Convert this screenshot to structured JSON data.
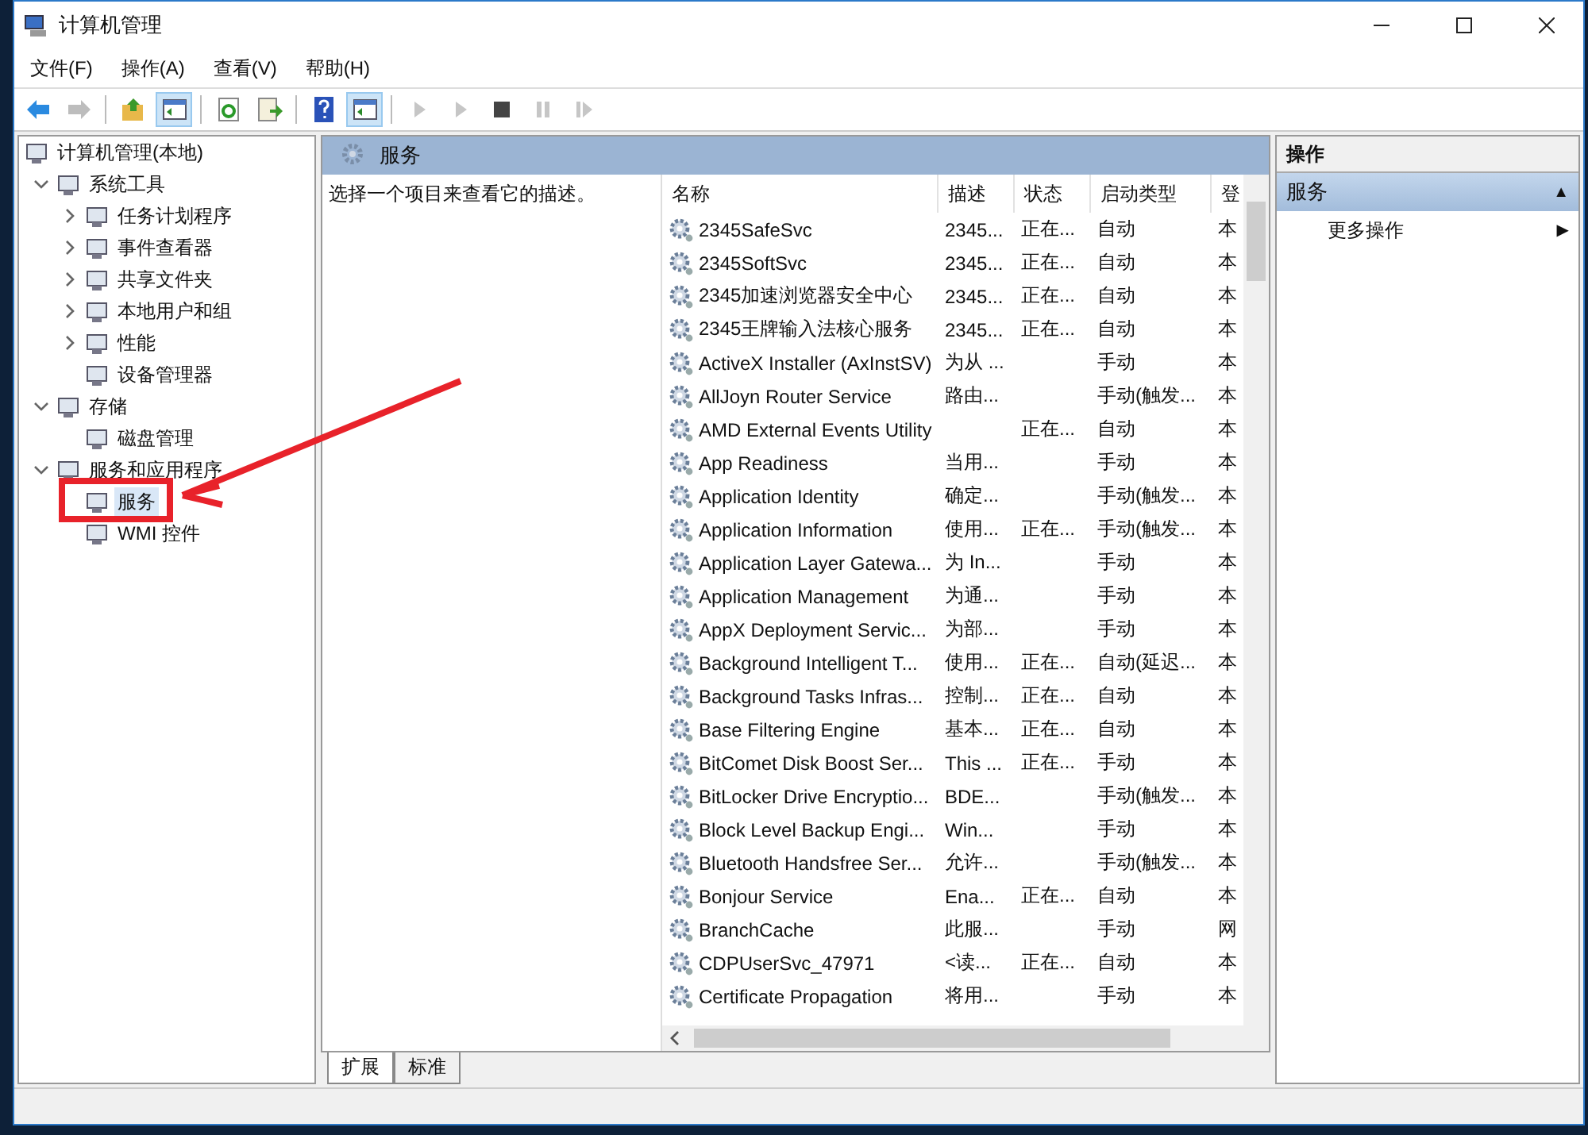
{
  "window": {
    "title": "计算机管理"
  },
  "menu": [
    "文件(F)",
    "操作(A)",
    "查看(V)",
    "帮助(H)"
  ],
  "toolbar": [
    {
      "kind": "back",
      "pressed": false,
      "disabled": false
    },
    {
      "kind": "forward",
      "pressed": false,
      "disabled": true
    },
    {
      "kind": "sep"
    },
    {
      "kind": "up",
      "pressed": false,
      "disabled": false
    },
    {
      "kind": "tree",
      "pressed": true,
      "disabled": false
    },
    {
      "kind": "sep"
    },
    {
      "kind": "refresh",
      "pressed": false,
      "disabled": false
    },
    {
      "kind": "export",
      "pressed": false,
      "disabled": false
    },
    {
      "kind": "sep"
    },
    {
      "kind": "help",
      "pressed": false,
      "disabled": false
    },
    {
      "kind": "panel",
      "pressed": true,
      "disabled": false
    },
    {
      "kind": "sep"
    },
    {
      "kind": "play",
      "pressed": false,
      "disabled": true
    },
    {
      "kind": "play",
      "pressed": false,
      "disabled": true
    },
    {
      "kind": "stop",
      "pressed": false,
      "disabled": false
    },
    {
      "kind": "pause",
      "pressed": false,
      "disabled": true
    },
    {
      "kind": "resume",
      "pressed": false,
      "disabled": true
    }
  ],
  "tree": {
    "label": "计算机管理(本地)",
    "selected": false,
    "children": [
      {
        "label": "系统工具",
        "selected": false,
        "expanded": true,
        "children": [
          {
            "label": "任务计划程序",
            "selected": false,
            "expanded": false
          },
          {
            "label": "事件查看器",
            "selected": false,
            "expanded": false
          },
          {
            "label": "共享文件夹",
            "selected": false,
            "expanded": false
          },
          {
            "label": "本地用户和组",
            "selected": false,
            "expanded": false
          },
          {
            "label": "性能",
            "selected": false,
            "expanded": false
          },
          {
            "label": "设备管理器",
            "selected": false
          }
        ]
      },
      {
        "label": "存储",
        "selected": false,
        "expanded": true,
        "children": [
          {
            "label": "磁盘管理",
            "selected": false
          }
        ]
      },
      {
        "label": "服务和应用程序",
        "selected": false,
        "expanded": true,
        "children": [
          {
            "label": "服务",
            "selected": true
          },
          {
            "label": "WMI 控件",
            "selected": false
          }
        ]
      }
    ]
  },
  "services_pane": {
    "title": "服务",
    "description": "选择一个项目来查看它的描述。",
    "columns": [
      "名称",
      "描述",
      "状态",
      "启动类型",
      "登"
    ],
    "rows": [
      [
        "2345SafeSvc",
        "2345...",
        "正在...",
        "自动",
        "本"
      ],
      [
        "2345SoftSvc",
        "2345...",
        "正在...",
        "自动",
        "本"
      ],
      [
        "2345加速浏览器安全中心",
        "2345...",
        "正在...",
        "自动",
        "本"
      ],
      [
        "2345王牌输入法核心服务",
        "2345...",
        "正在...",
        "自动",
        "本"
      ],
      [
        "ActiveX Installer (AxInstSV)",
        "为从 ...",
        "",
        "手动",
        "本"
      ],
      [
        "AllJoyn Router Service",
        "路由...",
        "",
        "手动(触发...",
        "本"
      ],
      [
        "AMD External Events Utility",
        "",
        "正在...",
        "自动",
        "本"
      ],
      [
        "App Readiness",
        "当用...",
        "",
        "手动",
        "本"
      ],
      [
        "Application Identity",
        "确定...",
        "",
        "手动(触发...",
        "本"
      ],
      [
        "Application Information",
        "使用...",
        "正在...",
        "手动(触发...",
        "本"
      ],
      [
        "Application Layer Gatewa...",
        "为 In...",
        "",
        "手动",
        "本"
      ],
      [
        "Application Management",
        "为通...",
        "",
        "手动",
        "本"
      ],
      [
        "AppX Deployment Servic...",
        "为部...",
        "",
        "手动",
        "本"
      ],
      [
        "Background Intelligent T...",
        "使用...",
        "正在...",
        "自动(延迟...",
        "本"
      ],
      [
        "Background Tasks Infras...",
        "控制...",
        "正在...",
        "自动",
        "本"
      ],
      [
        "Base Filtering Engine",
        "基本...",
        "正在...",
        "自动",
        "本"
      ],
      [
        "BitComet Disk Boost Ser...",
        "This ...",
        "正在...",
        "手动",
        "本"
      ],
      [
        "BitLocker Drive Encryptio...",
        "BDE...",
        "",
        "手动(触发...",
        "本"
      ],
      [
        "Block Level Backup Engi...",
        "Win...",
        "",
        "手动",
        "本"
      ],
      [
        "Bluetooth Handsfree Ser...",
        "允许...",
        "",
        "手动(触发...",
        "本"
      ],
      [
        "Bonjour Service",
        "Ena...",
        "正在...",
        "自动",
        "本"
      ],
      [
        "BranchCache",
        "此服...",
        "",
        "手动",
        "网"
      ],
      [
        "CDPUserSvc_47971",
        "<读...",
        "正在...",
        "自动",
        "本"
      ],
      [
        "Certificate Propagation",
        "将用...",
        "",
        "手动",
        "本"
      ]
    ],
    "tabs": [
      {
        "label": "扩展",
        "selected": true
      },
      {
        "label": "标准",
        "selected": false
      }
    ]
  },
  "actions_pane": {
    "title": "操作",
    "section": {
      "label": "服务",
      "arrow": "▲"
    },
    "items": [
      {
        "label": "更多操作",
        "arrow": "▶"
      }
    ]
  }
}
